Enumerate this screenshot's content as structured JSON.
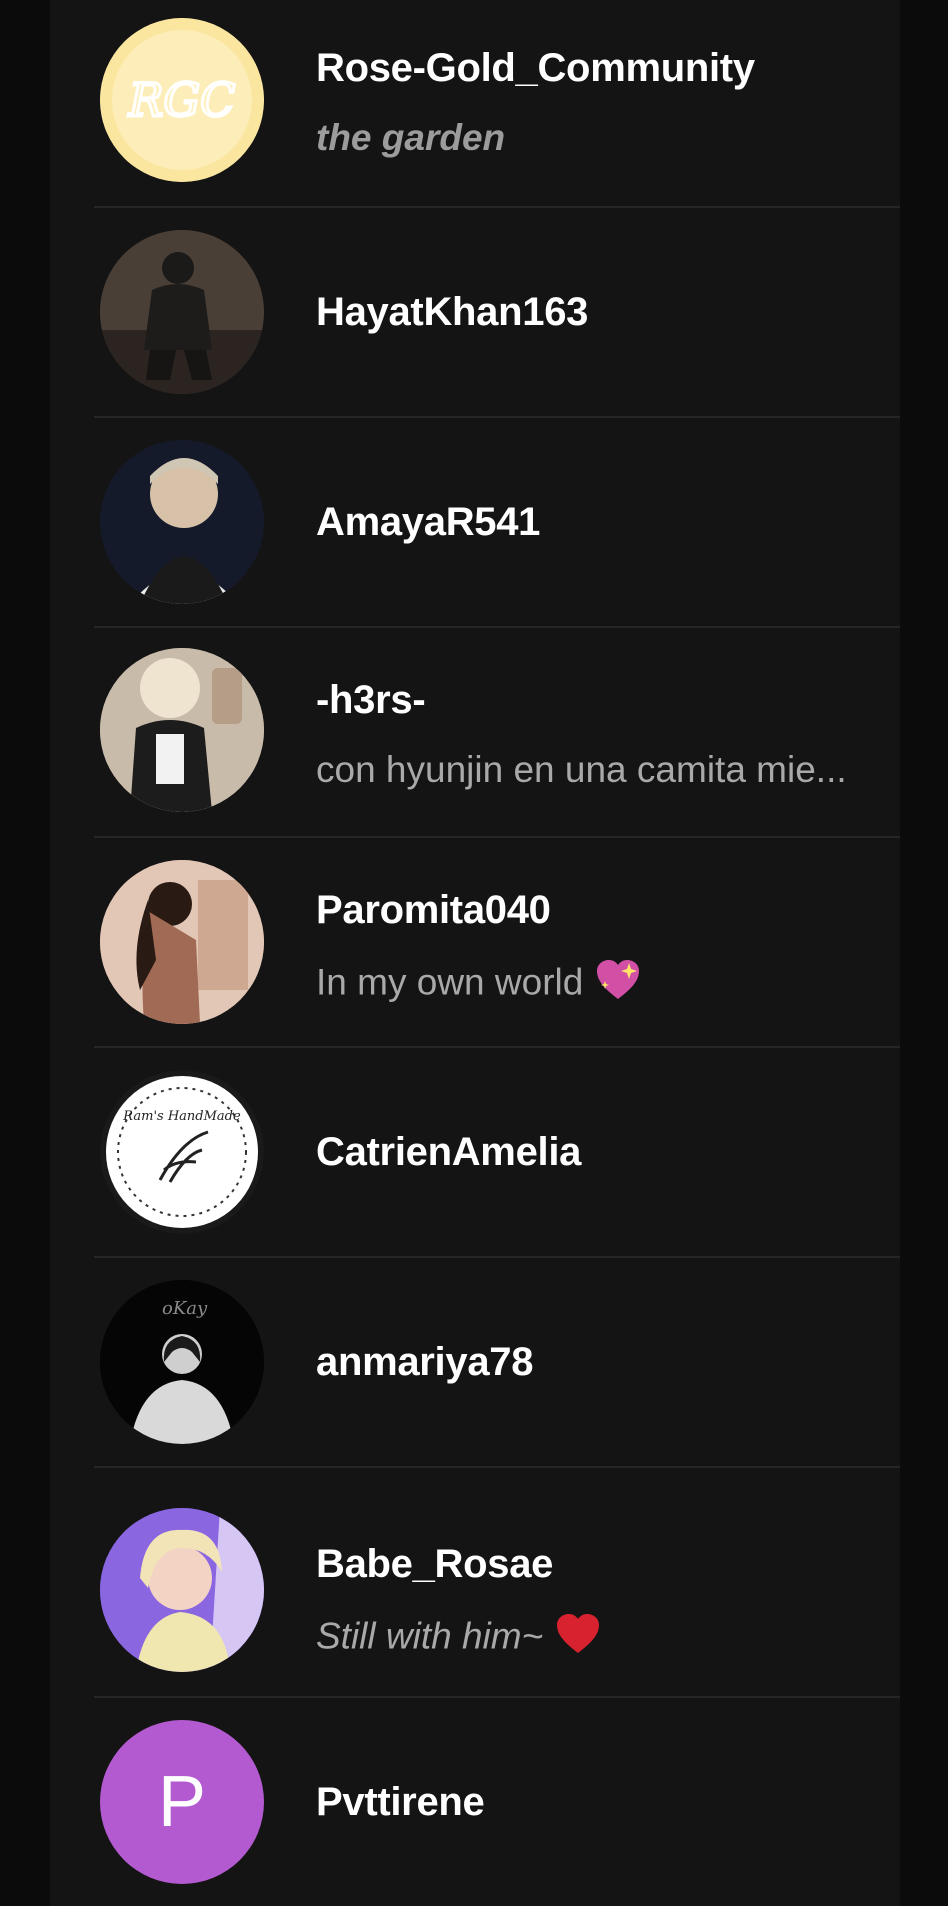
{
  "users": [
    {
      "name": "Rose-Gold_Community",
      "status": "the garden",
      "avatar_icon": "rgc-logo-avatar"
    },
    {
      "name": "HayatKhan163",
      "status": "",
      "avatar_icon": "photo-avatar"
    },
    {
      "name": "AmayaR541",
      "status": "",
      "avatar_icon": "photo-avatar"
    },
    {
      "name": "-h3rs-",
      "status": "con hyunjin en una camita mie...",
      "avatar_icon": "photo-avatar"
    },
    {
      "name": "Paromita040",
      "status": "In my own world",
      "avatar_icon": "photo-avatar",
      "status_emoji": "sparkling-heart-icon"
    },
    {
      "name": "CatrienAmelia",
      "status": "",
      "avatar_icon": "handmade-logo-avatar"
    },
    {
      "name": "anmariya78",
      "status": "",
      "avatar_icon": "photo-avatar"
    },
    {
      "name": "Babe_Rosae",
      "status": "Still with him~",
      "avatar_icon": "photo-avatar",
      "status_emoji": "red-heart-icon"
    },
    {
      "name": "Pvttirene",
      "status": "",
      "avatar_letter": "P",
      "avatar_color": "#b45ad1"
    }
  ],
  "avatar_texts": {
    "rgc": "RGC",
    "handmade": "Ram's HandMade",
    "okay": "oKay"
  },
  "colors": {
    "background": "#0b0b0b",
    "panel": "#141414",
    "divider": "#262626",
    "name_text": "#ffffff",
    "status_text": "#a9a9a9",
    "accent_purple": "#b45ad1"
  }
}
